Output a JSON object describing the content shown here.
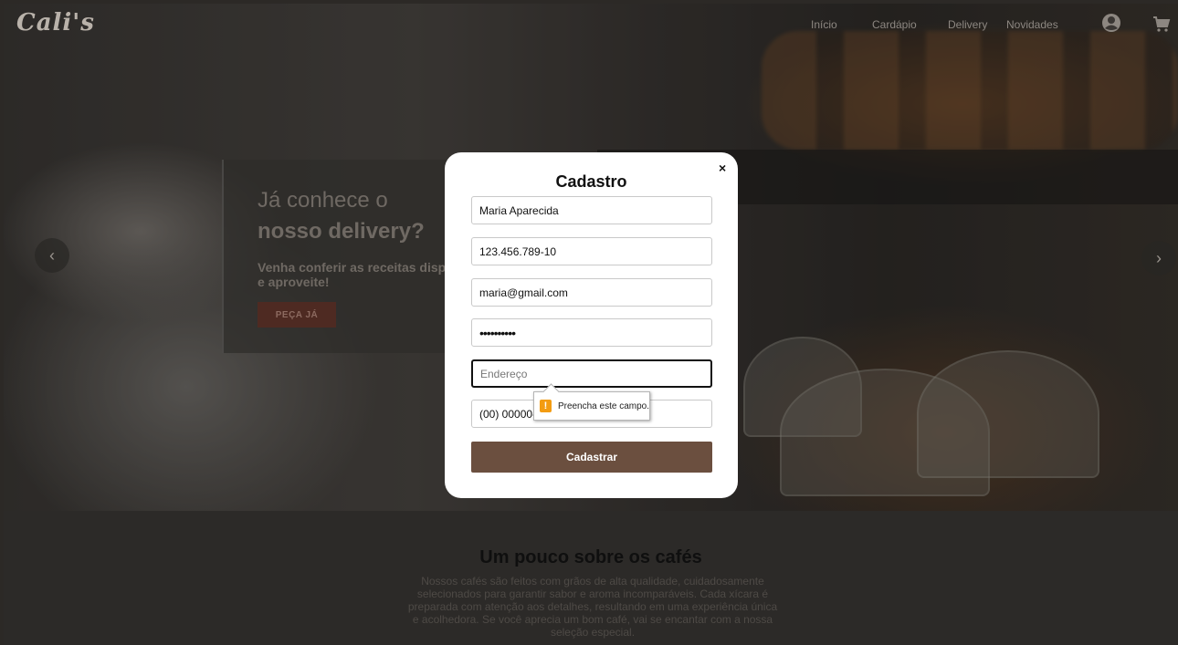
{
  "header": {
    "logo": "Cali's",
    "nav": [
      "Início",
      "Cardápio",
      "Delivery",
      "Novidades"
    ]
  },
  "hero": {
    "title_line1": "Já conhece o",
    "title_line2": "nosso delivery?",
    "subtitle_line1": "Venha conferir as receitas dispo",
    "subtitle_line2": "e aproveite!",
    "cta": "PEÇA JÁ",
    "prev_arrow": "‹",
    "next_arrow": "›"
  },
  "modal": {
    "title": "Cadastro",
    "close": "×",
    "fields": {
      "name": "Maria Aparecida",
      "cpf": "123.456.789-10",
      "email": "maria@gmail.com",
      "password": "••••••••••",
      "address_placeholder": "Endereço",
      "phone": "(00) 00000-0000"
    },
    "submit": "Cadastrar",
    "validation": {
      "icon": "!",
      "message": "Preencha este campo."
    }
  },
  "about": {
    "title": "Um pouco sobre os cafés",
    "text": "Nossos cafés são feitos com grãos de alta qualidade, cuidadosamente selecionados para garantir sabor e aroma incomparáveis. Cada xícara é preparada com atenção aos detalhes, resultando em uma experiência única e acolhedora. Se você aprecia um bom café, vai se encantar com a nossa seleção especial."
  },
  "colors": {
    "brand_button": "#6b4f3f",
    "cta_dark": "#4e2a22",
    "warning": "#f39c12"
  },
  "icons": {
    "user": "user-icon",
    "cart": "cart-icon",
    "close": "close-icon",
    "warning": "warning-icon"
  }
}
